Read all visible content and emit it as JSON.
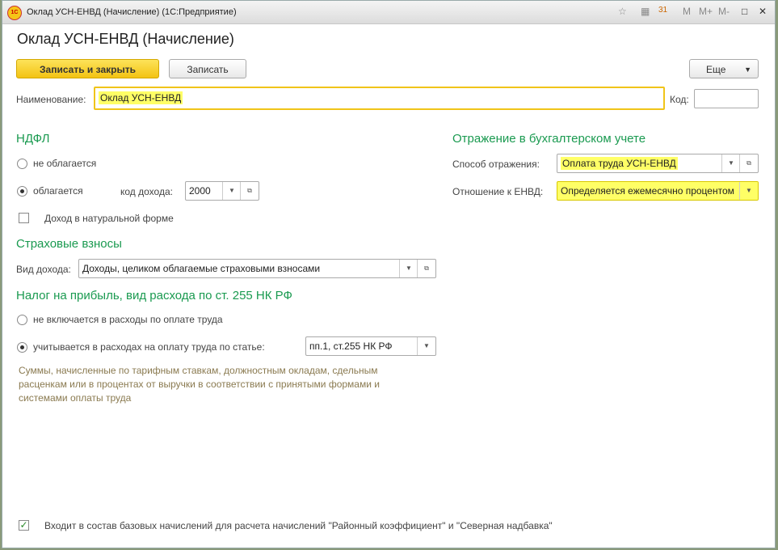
{
  "window": {
    "title": "Оклад УСН-ЕНВД (Начисление)  (1С:Предприятие)",
    "logo": "1С",
    "tools": [
      "☆",
      "▦",
      "31",
      "M",
      "M+",
      "M-",
      "□",
      "✕"
    ]
  },
  "form": {
    "title": "Оклад УСН-ЕНВД (Начисление)",
    "buttons": {
      "save_close": "Записать и закрыть",
      "save": "Записать",
      "more": "Еще"
    },
    "name_label": "Наименование:",
    "name_value": "Оклад УСН-ЕНВД",
    "code_label": "Код:",
    "code_value": "",
    "ndfl": {
      "title": "НДФЛ",
      "not_taxed": "не облагается",
      "taxed": "облагается",
      "income_code_label": "код дохода:",
      "income_code": "2000",
      "in_kind": "Доход в натуральной форме"
    },
    "insurance": {
      "title": "Страховые взносы",
      "income_type_label": "Вид дохода:",
      "income_type": "Доходы, целиком облагаемые страховыми взносами"
    },
    "profit_tax": {
      "title": "Налог на прибыль, вид расхода по ст. 255 НК РФ",
      "not_included": "не включается в расходы по оплате труда",
      "included": "учитывается в расходах на оплату труда по статье:",
      "article": "пп.1, ст.255 НК РФ",
      "note": "Суммы, начисленные по тарифным ставкам, должностным окладам, сдельным расценкам или в процентах от выручки в соответствии с принятыми формами и системами оплаты труда"
    },
    "accounting": {
      "title": "Отражение в бухгалтерском учете",
      "method_label": "Способ отражения:",
      "method": "Оплата труда УСН-ЕНВД",
      "envd_label": "Отношение к ЕНВД:",
      "envd": "Определяется ежемесячно процентом"
    },
    "base_accruals": "Входит в состав базовых начислений для расчета начислений \"Районный коэффициент\" и \"Северная надбавка\""
  }
}
